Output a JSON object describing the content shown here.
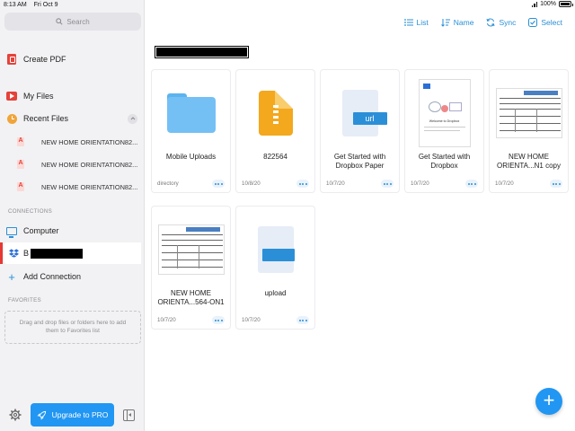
{
  "status_bar": {
    "time": "8:13 AM",
    "date": "Fri Oct 9",
    "battery": "100%"
  },
  "sidebar": {
    "search_placeholder": "Search",
    "create_pdf": "Create PDF",
    "my_files": "My Files",
    "recent_files": "Recent Files",
    "recent_items": [
      "NEW HOME ORIENTATION82...",
      "NEW HOME ORIENTATION82...",
      "NEW HOME ORIENTATION82..."
    ],
    "connections_label": "CONNECTIONS",
    "computer": "Computer",
    "dropbox_prefix": "B",
    "add_connection": "Add Connection",
    "favorites_label": "FAVORITES",
    "favorites_hint": "Drag and drop files or folders here to add them to Favorites list",
    "upgrade_label": "Upgrade to PRO"
  },
  "toolbar": {
    "list": "List",
    "name": "Name",
    "sync": "Sync",
    "select": "Select"
  },
  "page_title": "",
  "files": [
    {
      "name": "Mobile Uploads",
      "date": "directory",
      "icon": "folder-icon"
    },
    {
      "name": "822564",
      "date": "10/8/20",
      "icon": "zip-file-icon"
    },
    {
      "name": "Get Started with Dropbox Paper",
      "date": "10/7/20",
      "icon": "url-file-icon",
      "badge": "url"
    },
    {
      "name": "Get Started with Dropbox",
      "date": "10/7/20",
      "icon": "pdf-thumbnail",
      "caption": "Welcome to Dropbox"
    },
    {
      "name": "NEW HOME ORIENTA...N1 copy",
      "date": "10/7/20",
      "icon": "form-thumbnail"
    },
    {
      "name": "NEW HOME ORIENTA...564-ON1",
      "date": "10/7/20",
      "icon": "form-thumbnail"
    },
    {
      "name": "upload",
      "date": "10/7/20",
      "icon": "generic-file-icon"
    }
  ],
  "fab_label": "+"
}
